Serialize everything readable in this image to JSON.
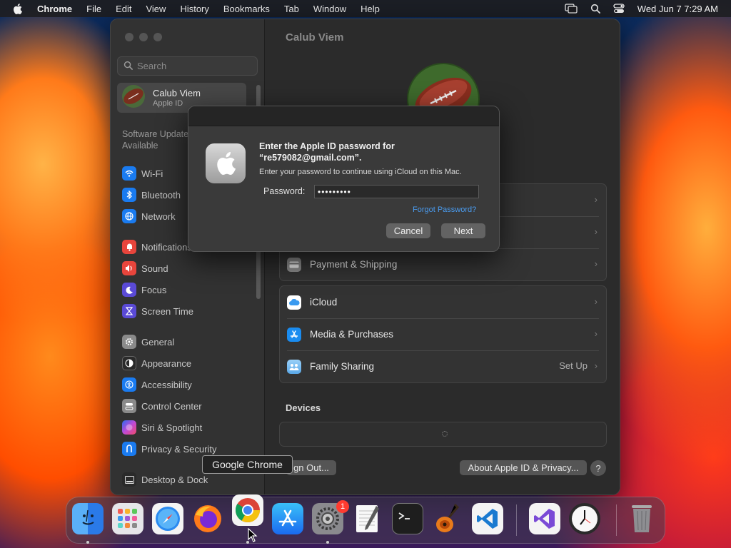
{
  "menubar": {
    "app": "Chrome",
    "items": [
      "File",
      "Edit",
      "View",
      "History",
      "Bookmarks",
      "Tab",
      "Window",
      "Help"
    ],
    "datetime": "Wed Jun 7  7:29 AM"
  },
  "sidebar": {
    "search_placeholder": "Search",
    "account_name": "Calub Viem",
    "account_sub": "Apple ID",
    "update_line1": "Software Update",
    "update_line2": "Available",
    "items": [
      {
        "label": "Wi-Fi",
        "icon": "wifi-icon",
        "color": "#1a7bf0"
      },
      {
        "label": "Bluetooth",
        "icon": "bluetooth-icon",
        "color": "#1a7bf0"
      },
      {
        "label": "Network",
        "icon": "network-icon",
        "color": "#1a7bf0"
      },
      {
        "label": "Notifications",
        "icon": "notifications-icon",
        "color": "#e8453c"
      },
      {
        "label": "Sound",
        "icon": "sound-icon",
        "color": "#e8453c"
      },
      {
        "label": "Focus",
        "icon": "focus-icon",
        "color": "#5a4ad6"
      },
      {
        "label": "Screen Time",
        "icon": "screen-time-icon",
        "color": "#5a4ad6"
      },
      {
        "label": "General",
        "icon": "general-icon",
        "color": "#8a8a8a"
      },
      {
        "label": "Appearance",
        "icon": "appearance-icon",
        "color": "#2a2a2a"
      },
      {
        "label": "Accessibility",
        "icon": "accessibility-icon",
        "color": "#1a7bf0"
      },
      {
        "label": "Control Center",
        "icon": "control-center-icon",
        "color": "#8a8a8a"
      },
      {
        "label": "Siri & Spotlight",
        "icon": "siri-icon",
        "color": "#c04ad6"
      },
      {
        "label": "Privacy & Security",
        "icon": "privacy-icon",
        "color": "#1a7bf0"
      },
      {
        "label": "Desktop & Dock",
        "icon": "desktop-dock-icon",
        "color": "#2a2a2a"
      }
    ]
  },
  "main": {
    "title": "Calub Viem",
    "payment_label": "Payment & Shipping",
    "icloud_label": "iCloud",
    "media_label": "Media & Purchases",
    "family_label": "Family Sharing",
    "family_value": "Set Up",
    "devices_title": "Devices",
    "sign_out_label": "gn Out...",
    "about_label": "About Apple ID & Privacy...",
    "help_label": "?"
  },
  "dialog": {
    "title_line1": "Enter the Apple ID password for",
    "title_line2": "“re579082@gmail.com”.",
    "description": "Enter your password to continue using iCloud on this Mac.",
    "password_label": "Password:",
    "password_value": "•••••••••",
    "forgot_label": "Forgot Password?",
    "cancel_label": "Cancel",
    "next_label": "Next"
  },
  "tooltip": "Google Chrome",
  "dock": {
    "apps": [
      "Finder",
      "Launchpad",
      "Safari",
      "Firefox",
      "Google Chrome",
      "App Store",
      "System Settings",
      "TextEdit",
      "Terminal",
      "GarageBand",
      "Visual Studio Code",
      "Visual Studio",
      "Clock",
      "Trash"
    ],
    "settings_badge": "1"
  }
}
